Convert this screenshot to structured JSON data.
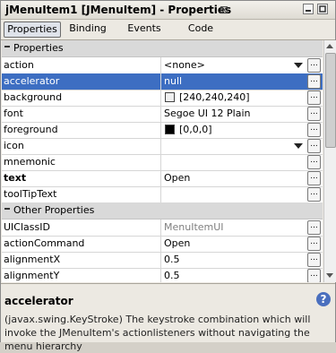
{
  "window": {
    "title": "jMenuItem1 [JMenuItem] - Properties"
  },
  "tabs": [
    {
      "label": "Properties",
      "selected": true
    },
    {
      "label": "Binding"
    },
    {
      "label": "Events"
    },
    {
      "label": "Code"
    }
  ],
  "sections": [
    {
      "label": "Properties",
      "expanded": true
    },
    {
      "label": "Other Properties",
      "expanded": true
    }
  ],
  "properties": [
    {
      "name": "action",
      "value": "<none>",
      "dropdown": true
    },
    {
      "name": "accelerator",
      "value": "null",
      "selected": true
    },
    {
      "name": "background",
      "value": "[240,240,240]",
      "swatch": "#f0f0f0"
    },
    {
      "name": "font",
      "value": "Segoe UI 12 Plain"
    },
    {
      "name": "foreground",
      "value": "[0,0,0]",
      "swatch": "#000000"
    },
    {
      "name": "icon",
      "value": "",
      "dropdown": true
    },
    {
      "name": "mnemonic",
      "value": ""
    },
    {
      "name": "text",
      "value": "Open",
      "bold": true
    },
    {
      "name": "toolTipText",
      "value": ""
    }
  ],
  "other_properties": [
    {
      "name": "UIClassID",
      "value": "MenuItemUI",
      "readonly": true
    },
    {
      "name": "actionCommand",
      "value": "Open"
    },
    {
      "name": "alignmentX",
      "value": "0.5"
    },
    {
      "name": "alignmentY",
      "value": "0.5"
    }
  ],
  "ellipsis_label": "...",
  "description": {
    "title": "accelerator",
    "text": "(javax.swing.KeyStroke) The keystroke combination which will invoke the JMenuItem's actionlisteners without navigating the menu hierarchy",
    "help_glyph": "?"
  },
  "colors": {
    "selection": "#3d6ec2",
    "section_bg": "#d9d9d9"
  }
}
